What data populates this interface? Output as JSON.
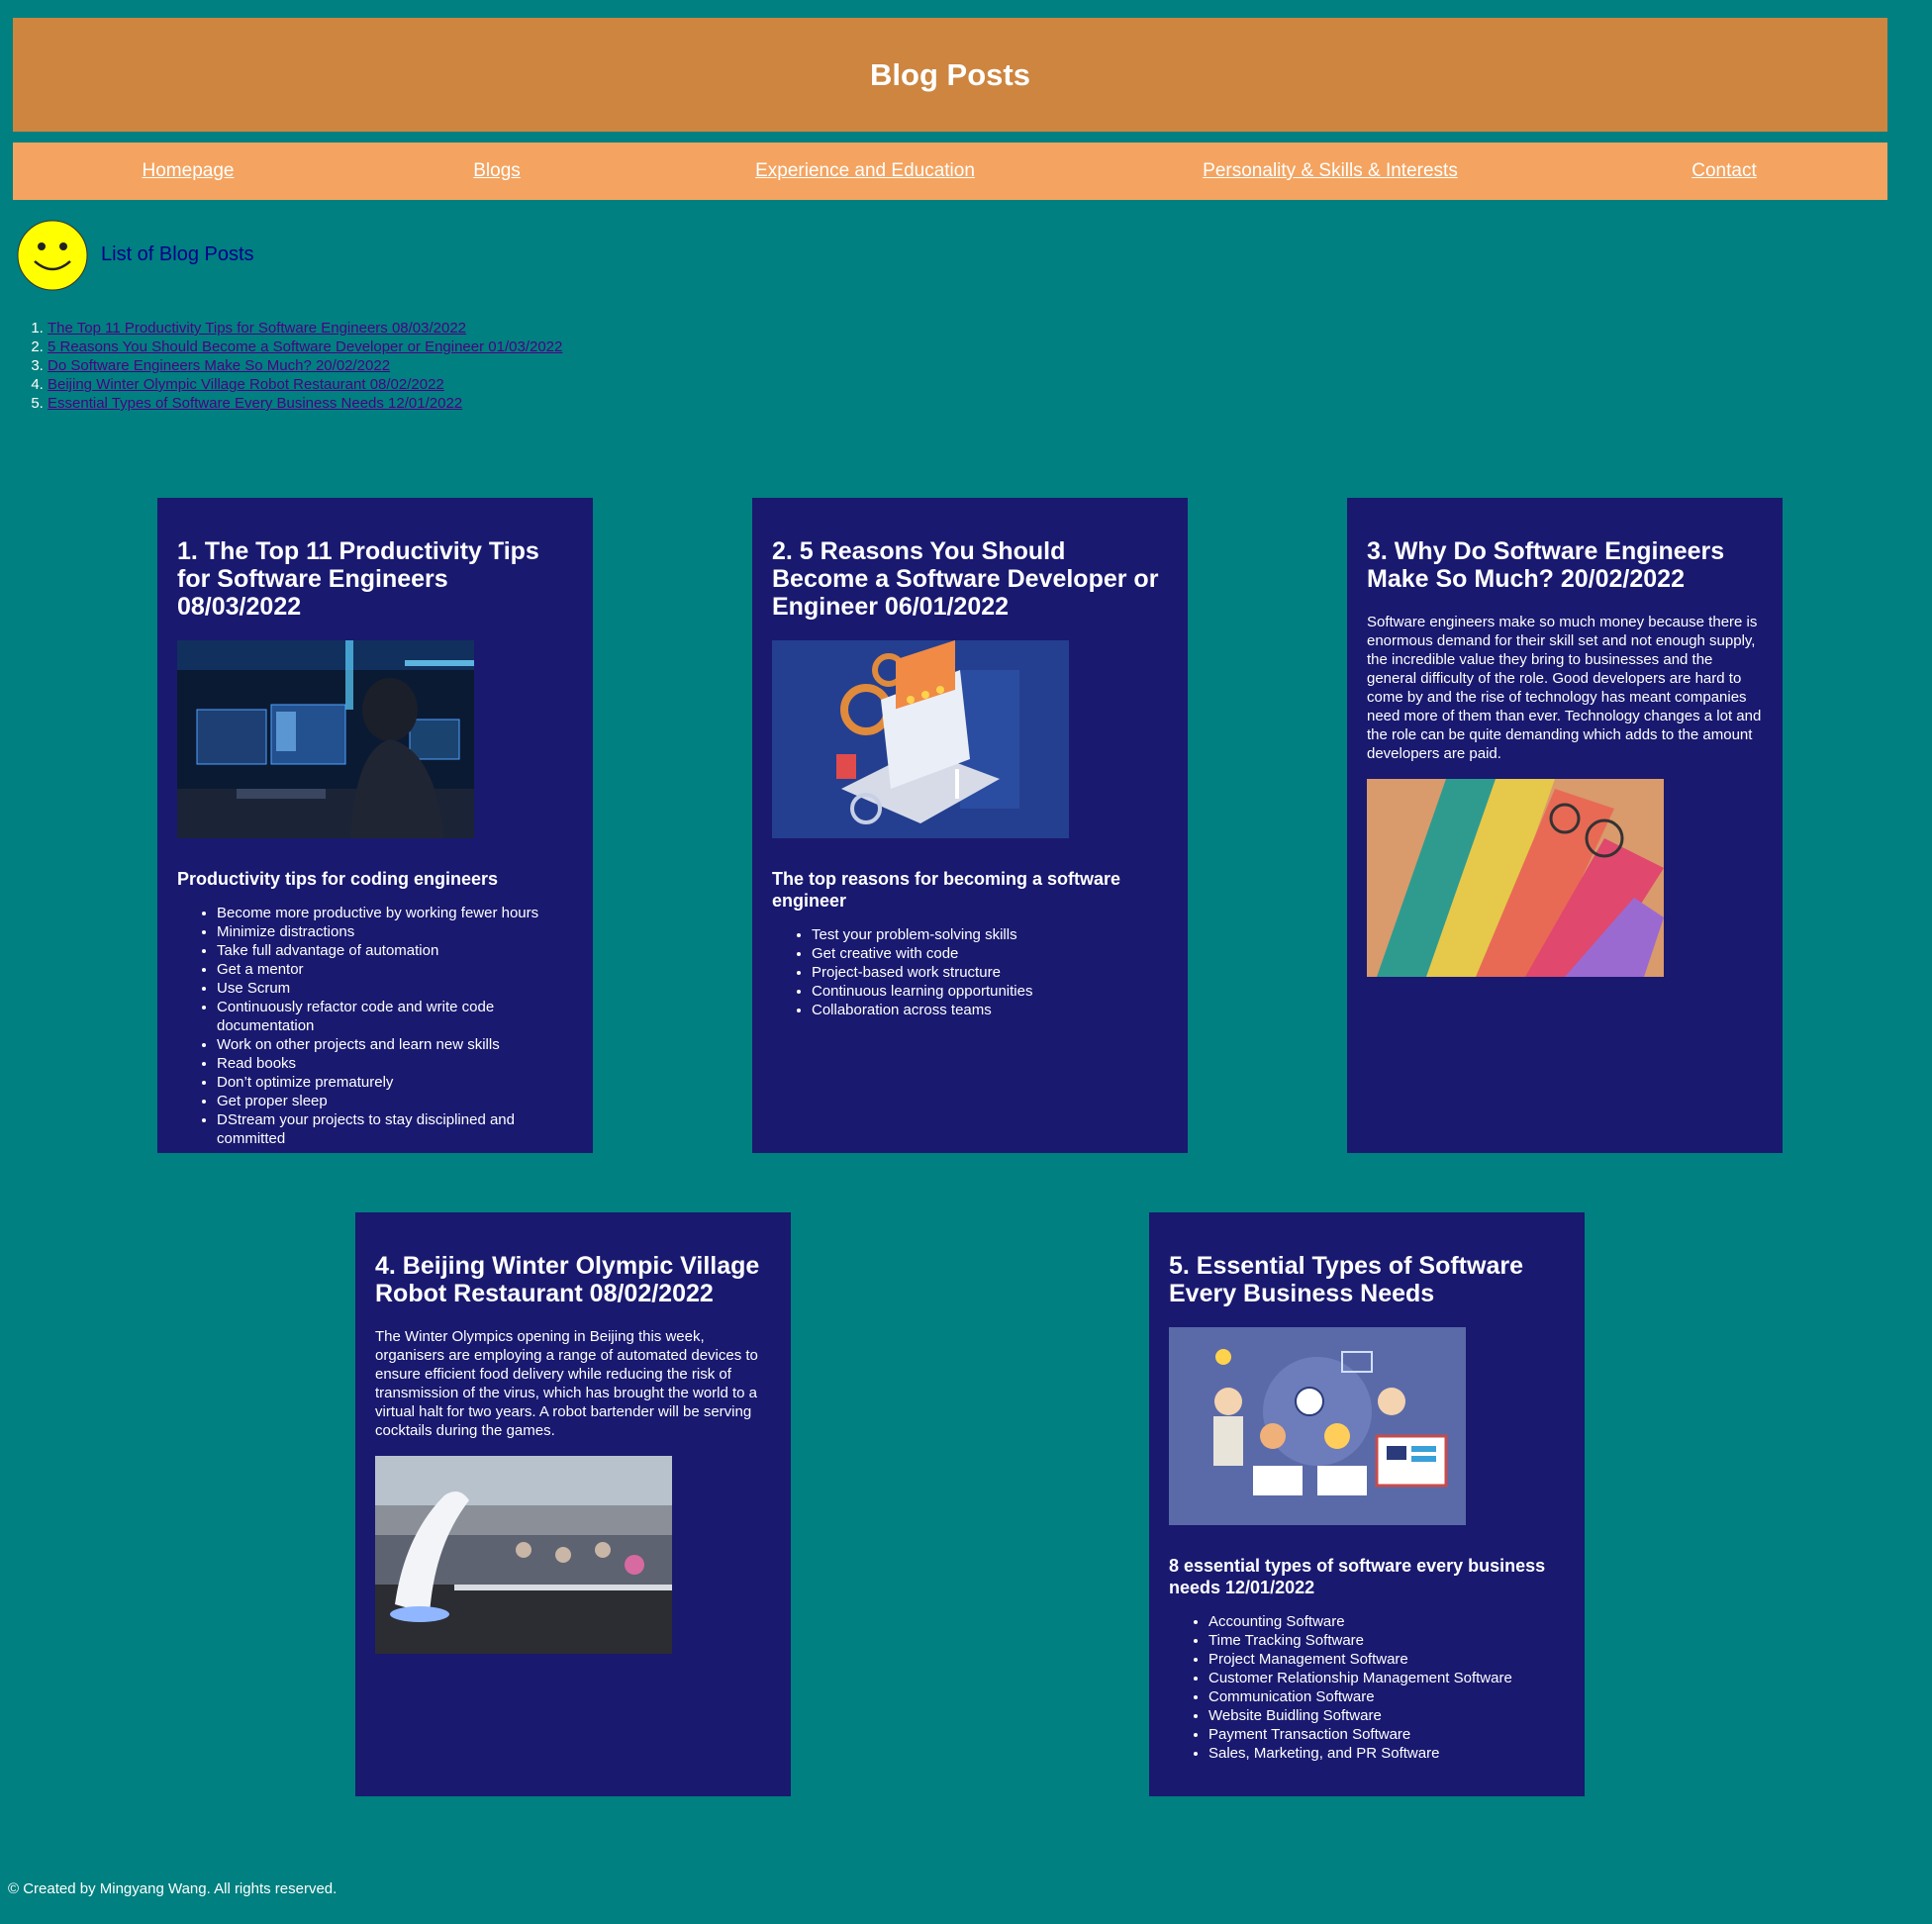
{
  "header": {
    "title": "Blog Posts"
  },
  "nav": {
    "items": [
      {
        "label": "Homepage"
      },
      {
        "label": "Blogs"
      },
      {
        "label": "Experience and Education"
      },
      {
        "label": "Personality & Skills & Interests"
      },
      {
        "label": "Contact"
      }
    ]
  },
  "list_section": {
    "icon": "smiley-face-icon",
    "heading": "List of Blog Posts",
    "links": [
      "The Top 11 Productivity Tips for Software Engineers 08/03/2022",
      "5 Reasons You Should Become a Software Developer or Engineer 01/03/2022",
      "Do Software Engineers Make So Much? 20/02/2022",
      "Beijing Winter Olympic Village Robot Restaurant 08/02/2022",
      "Essential Types of Software Every Business Needs 12/01/2022"
    ]
  },
  "posts": [
    {
      "title": "1. The Top 11 Productivity Tips for Software Engineers 08/03/2022",
      "image": "engineer-at-computer-photo",
      "subheading": "Productivity tips for coding engineers",
      "items": [
        "Become more productive by working fewer hours",
        "Minimize distractions",
        "Take full advantage of automation",
        "Get a mentor",
        "Use Scrum",
        "Continuously refactor code and write code documentation",
        "Work on other projects and learn new skills",
        "Read books",
        "Don’t optimize prematurely",
        "Get proper sleep",
        "DStream your projects to stay disciplined and committed"
      ]
    },
    {
      "title": "2. 5 Reasons You Should Become a Software Developer or Engineer 06/01/2022",
      "image": "laptop-gears-illustration",
      "subheading": "The top reasons for becoming a software engineer",
      "items": [
        "Test your problem-solving skills",
        "Get creative with code",
        "Project-based work structure",
        "Continuous learning opportunities",
        "Collaboration across teams"
      ]
    },
    {
      "title": "3. Why Do Software Engineers Make So Much? 20/02/2022",
      "paragraph": "Software engineers make so much money because there is enormous demand for their skill set and not enough supply, the incredible value they bring to businesses and the general difficulty of the role. Good developers are hard to come by and the rise of technology has meant companies need more of them than ever. Technology changes a lot and the role can be quite demanding which adds to the amount developers are paid.",
      "image": "banknotes-photo"
    },
    {
      "title": "4. Beijing Winter Olympic Village Robot Restaurant 08/02/2022",
      "paragraph": "The Winter Olympics opening in Beijing this week, organisers are employing a range of automated devices to ensure efficient food delivery while reducing the risk of transmission of the virus, which has brought the world to a virtual halt for two years. A robot bartender will be serving cocktails during the games.",
      "image": "robot-restaurant-photo"
    },
    {
      "title": "5. Essential Types of Software Every Business Needs",
      "image": "team-software-illustration",
      "subheading": "8 essential types of software every business needs 12/01/2022",
      "items": [
        "Accounting Software",
        "Time Tracking Software",
        "Project Management Software",
        "Customer Relationship Management Software",
        "Communication Software",
        "Website Buidling Software",
        "Payment Transaction Software",
        "Sales, Marketing, and PR Software"
      ]
    }
  ],
  "footer": {
    "text": "© Created by Mingyang Wang. All rights reserved."
  },
  "colors": {
    "background": "#008080",
    "header": "#cd853f",
    "nav": "#f4a460",
    "card": "#191970",
    "list_heading": "#00008b",
    "link": "#4b0082",
    "smiley": "#ffff00"
  }
}
